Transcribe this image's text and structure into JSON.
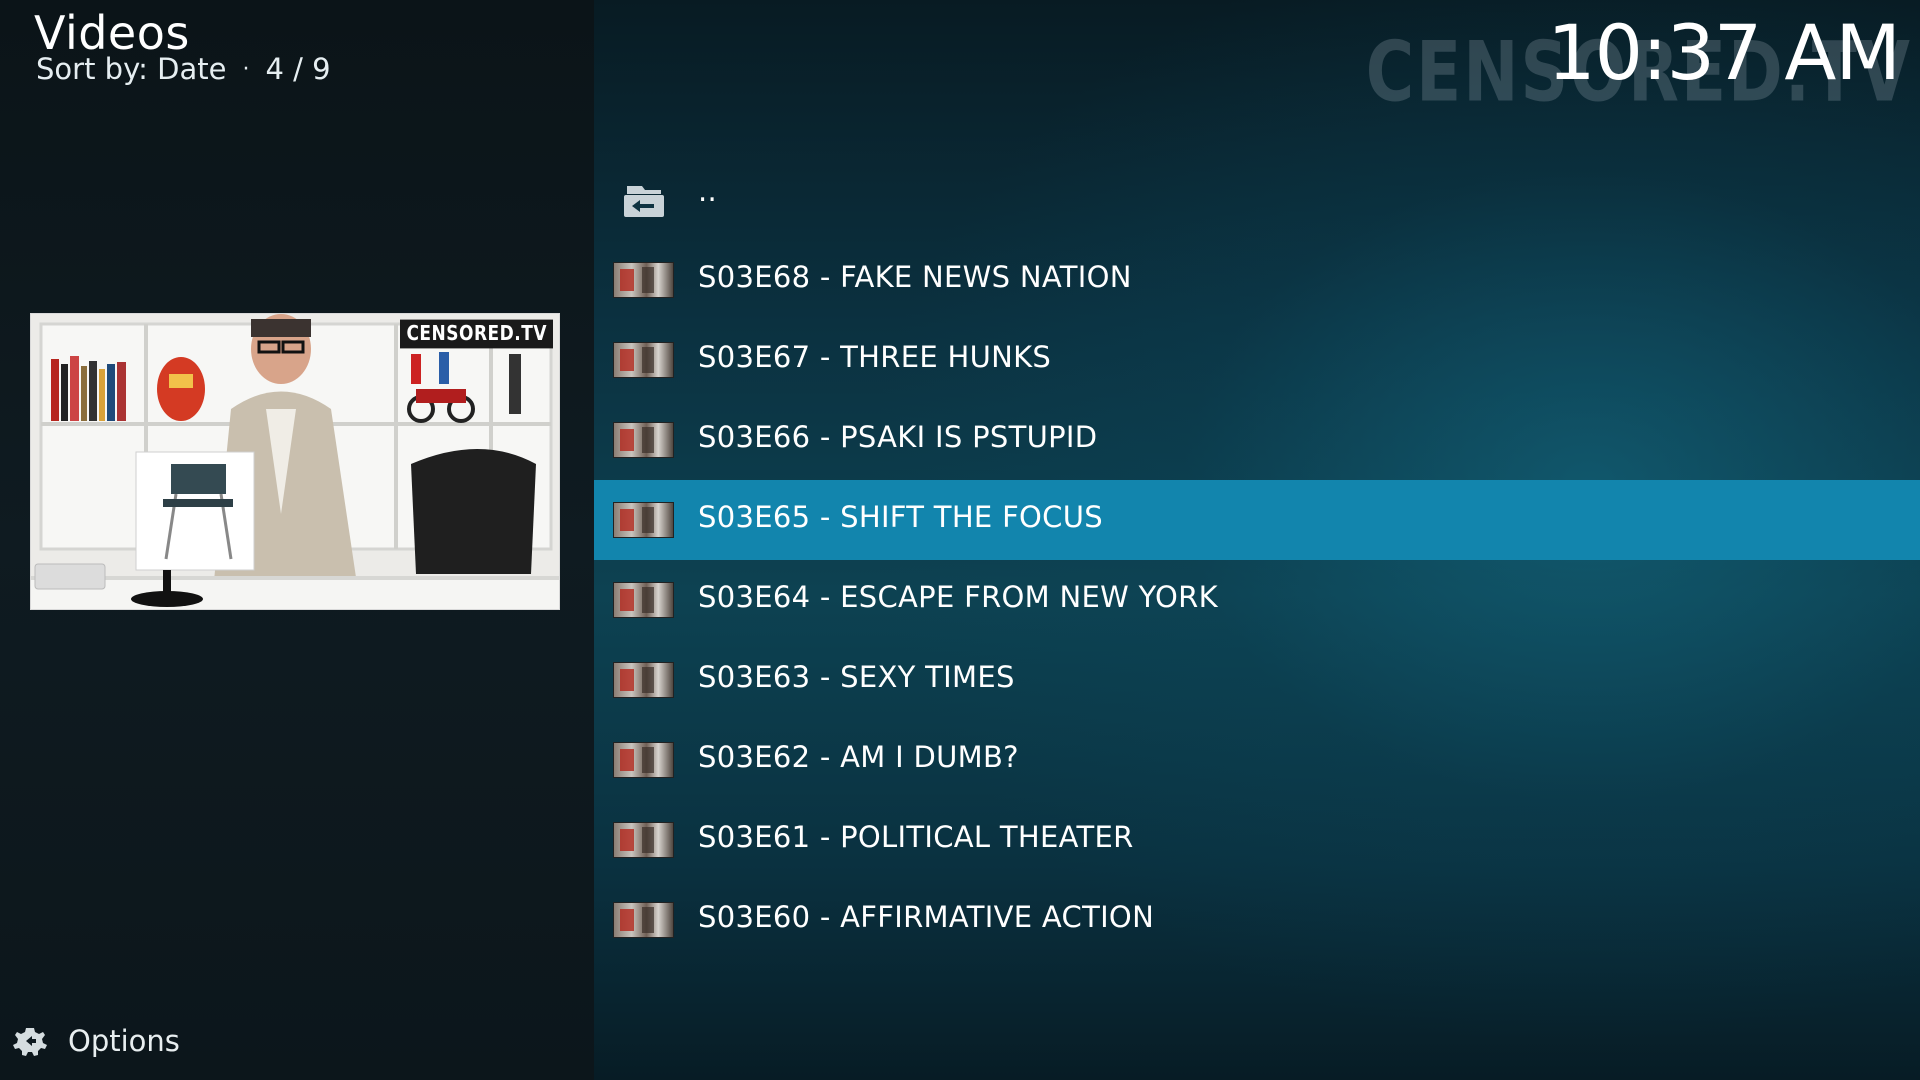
{
  "header": {
    "title": "Videos",
    "sort_label": "Sort by: Date",
    "separator": "·",
    "position": "4 / 9",
    "clock": "10:37 AM",
    "watermark": "CENSORED.TV"
  },
  "preview": {
    "brand": "CENSORED.TV"
  },
  "list": {
    "items": [
      {
        "label": "..",
        "icon": "folder-back-icon",
        "kind": "parent"
      },
      {
        "label": "S03E68 - FAKE NEWS NATION",
        "icon": "episode-thumbnail"
      },
      {
        "label": "S03E67 - THREE HUNKS",
        "icon": "episode-thumbnail"
      },
      {
        "label": "S03E66 - PSAKI IS PSTUPID",
        "icon": "episode-thumbnail"
      },
      {
        "label": "S03E65 - SHIFT THE FOCUS",
        "icon": "episode-thumbnail",
        "selected": true
      },
      {
        "label": "S03E64 - ESCAPE FROM NEW YORK",
        "icon": "episode-thumbnail"
      },
      {
        "label": "S03E63 - SEXY TIMES",
        "icon": "episode-thumbnail"
      },
      {
        "label": "S03E62 - AM I DUMB?",
        "icon": "episode-thumbnail"
      },
      {
        "label": "S03E61 - POLITICAL THEATER",
        "icon": "episode-thumbnail"
      },
      {
        "label": "S03E60 - AFFIRMATIVE ACTION",
        "icon": "episode-thumbnail"
      }
    ]
  },
  "footer": {
    "options_label": "Options",
    "options_icon": "options-gear-icon"
  },
  "colors": {
    "selection": "#1285ad",
    "left_panel": "#0e1a20",
    "right_panel": "#0d4252"
  }
}
